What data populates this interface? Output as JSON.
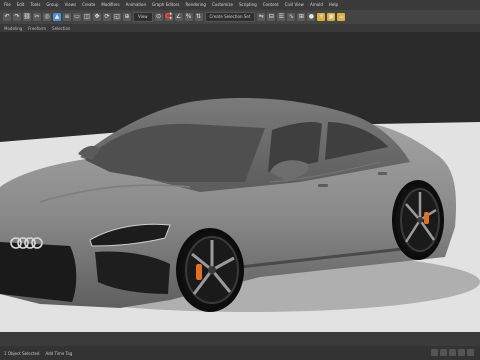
{
  "menu": {
    "items": [
      "File",
      "Edit",
      "Tools",
      "Group",
      "Views",
      "Create",
      "Modifiers",
      "Animation",
      "Graph Editors",
      "Rendering",
      "Customize",
      "Scripting",
      "Content",
      "Civil View",
      "Arnold",
      "Help"
    ]
  },
  "toolbar": {
    "view_dropdown": "View",
    "selection_set": "Create Selection Set",
    "color_accent": "#4a8fd8",
    "color_yellow": "#d7b13a"
  },
  "ribbon": {
    "items": [
      "Modeling",
      "Freeform",
      "Selection"
    ]
  },
  "viewport": {
    "background": "#2b2b2b",
    "floor_color": "#e2e2e2",
    "car_body_color": "#8b8b8b",
    "brake_caliper_color": "#e2701d",
    "brand_logo": "four-rings"
  },
  "status": {
    "left": "1 Object Selected",
    "right": "Add Time Tag"
  }
}
